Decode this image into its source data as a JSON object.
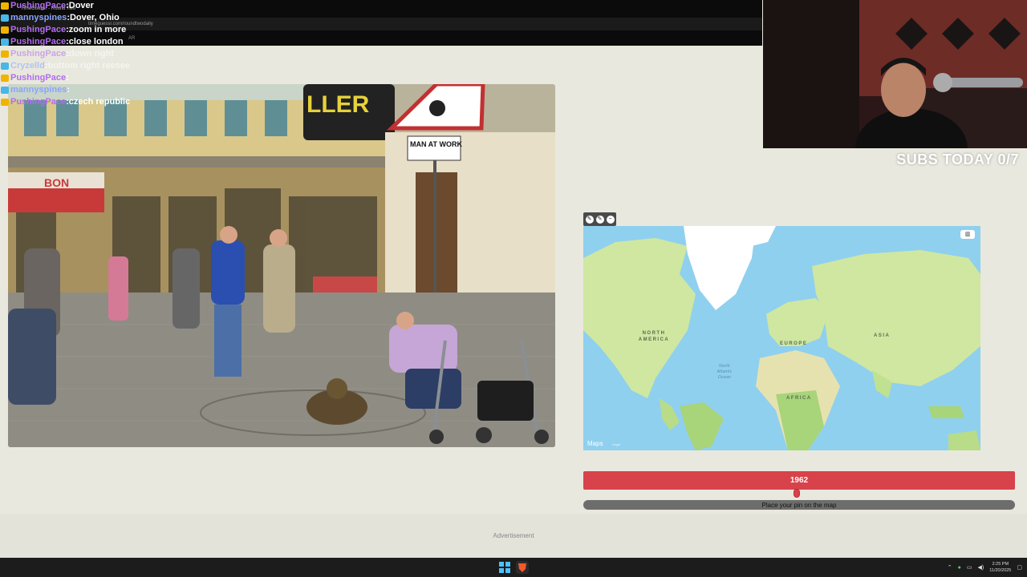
{
  "browser": {
    "tab_title": "TimeGuessr - Round Two",
    "url": "timeguessr.com/roundtwodaily",
    "bookmark": "AR"
  },
  "chat": [
    {
      "user": "PushingPace",
      "message": "Dover",
      "color": "#b26cf0"
    },
    {
      "user": "mannyspines",
      "message": "Dover, Ohio",
      "color": "#8aa4ff"
    },
    {
      "user": "PushingPace",
      "message": "zoom in more",
      "color": "#b26cf0"
    },
    {
      "user": "PushingPace",
      "message": "close london",
      "color": "#b26cf0"
    },
    {
      "user": "PushingPace",
      "message": "down right",
      "color": "#b26cf0"
    },
    {
      "user": "Cryzelld",
      "message": "bottom right reesee",
      "color": "#8aa4ff"
    },
    {
      "user": "PushingPace",
      "message": "",
      "color": "#b26cf0"
    },
    {
      "user": "mannyspines",
      "message": "",
      "color": "#8aa4ff"
    },
    {
      "user": "PushingPace",
      "message": "czech republic",
      "color": "#b26cf0"
    }
  ],
  "photo": {
    "sign_text": "MAN AT WORK",
    "shop_sign": "LLER",
    "bon_sign": "BON"
  },
  "stream": {
    "subs_today": "SUBS TODAY 0/7"
  },
  "map": {
    "tools": [
      "✎",
      "✎",
      "−"
    ],
    "labels": {
      "north_america": "NORTH AMERICA",
      "europe": "EUROPE",
      "asia": "ASIA",
      "africa": "AFRICA",
      "ocean": "North Atlantic Ocean"
    },
    "brand": "Maps",
    "legal": "Legal",
    "corner_icon": "map-icon"
  },
  "year": {
    "value": "1962",
    "slider_fraction": 0.494,
    "color": "#d8424a"
  },
  "pin_prompt": "Place your pin on the map",
  "ad_label": "Advertisement",
  "taskbar": {
    "time": "2:25 PM",
    "date": "11/20/2025"
  }
}
